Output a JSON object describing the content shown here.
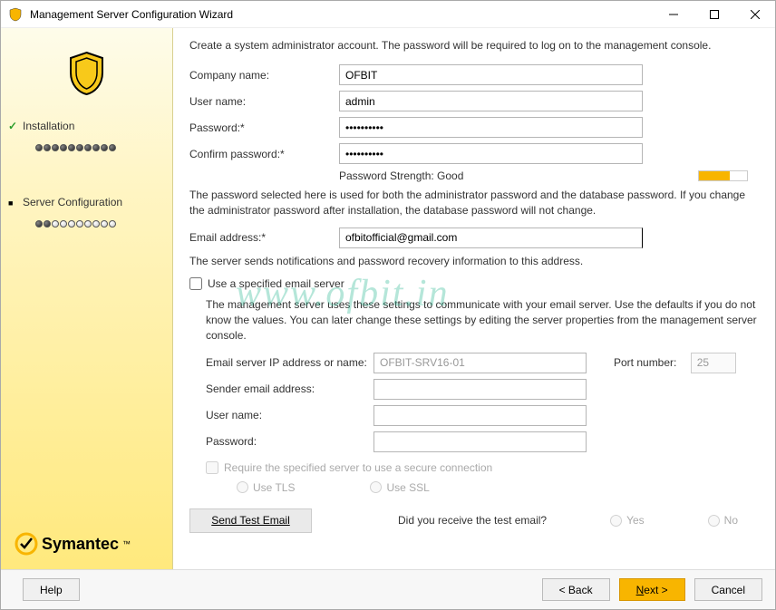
{
  "window": {
    "title": "Management Server Configuration Wizard"
  },
  "sidebar": {
    "steps": [
      {
        "label": "Installation"
      },
      {
        "label": "Server Configuration"
      }
    ]
  },
  "symantec_brand": "Symantec",
  "content": {
    "intro": "Create a system administrator account. The password will be required to log on to the management console.",
    "fields": {
      "company_label": "Company name:",
      "company_value": "OFBIT",
      "user_label": "User name:",
      "user_value": "admin",
      "password_label": "Password:*",
      "password_value": "••••••••••",
      "confirm_label": "Confirm password:*",
      "confirm_value": "••••••••••",
      "strength_label": "Password Strength: Good"
    },
    "password_note": "The password selected here is used for both the administrator password and the database password. If you change the administrator password after installation, the database password will not change.",
    "email_label": "Email address:*",
    "email_value": "ofbitofficial@gmail.com",
    "email_note": "The server sends notifications and password recovery information to this address.",
    "specified_server_label": "Use a specified email server",
    "server_note": "The management server uses these settings to communicate with your email server.  Use the defaults if you do not know the values. You can later change these settings by editing the server properties from the management server console.",
    "server_fields": {
      "ip_label": "Email server IP address or name:",
      "ip_value": "OFBIT-SRV16-01",
      "port_label": "Port number:",
      "port_value": "25",
      "sender_label": "Sender email address:",
      "username_label": "User name:",
      "serverpass_label": "Password:"
    },
    "secure_label": "Require the specified server to use a secure connection",
    "tls_label": "Use TLS",
    "ssl_label": "Use SSL",
    "test_button": "Send Test Email",
    "test_question": "Did you receive the test email?",
    "yes_label": "Yes",
    "no_label": "No"
  },
  "footer": {
    "help": "Help",
    "back": "< Back",
    "next": "Next >",
    "cancel": "Cancel"
  },
  "watermark": "www.ofbit.in"
}
